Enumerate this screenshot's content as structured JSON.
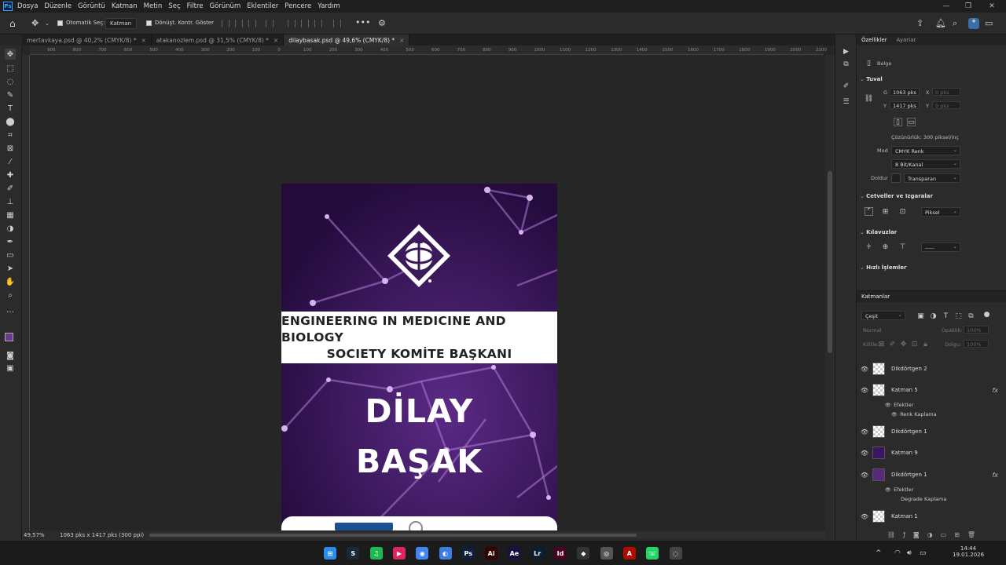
{
  "menu": {
    "items": [
      "Dosya",
      "Düzenle",
      "Görüntü",
      "Katman",
      "Metin",
      "Seç",
      "Filtre",
      "Görünüm",
      "Eklentiler",
      "Pencere",
      "Yardım"
    ],
    "logo": "Ps"
  },
  "options": {
    "auto_select_label": "Otomatik Seç:",
    "auto_select_value": "Katman",
    "transform_label": "Dönüşt. Kontr. Göster",
    "more": "•••"
  },
  "tabs": [
    {
      "label": "mertavkaya.psd @ 40,2% (CMYK/8) *",
      "close": "×"
    },
    {
      "label": "atakanozlem.psd @ 31,5% (CMYK/8) *",
      "close": "×"
    },
    {
      "label": "dilaybasak.psd @ 49,6% (CMYK/8) *",
      "close": "×"
    }
  ],
  "ruler_top": [
    "900",
    "800",
    "700",
    "600",
    "500",
    "400",
    "300",
    "200",
    "100",
    "0",
    "100",
    "200",
    "300",
    "400",
    "500",
    "600",
    "700",
    "800",
    "900",
    "1000",
    "1100",
    "1200",
    "1300",
    "1400",
    "1500",
    "1600",
    "1700",
    "1800",
    "1900",
    "2000",
    "2100"
  ],
  "document": {
    "band_line1": "ENGINEERING IN MEDICINE AND BIOLOGY",
    "band_line2": "SOCIETY KOMİTE BAŞKANI",
    "name_line1": "DİLAY",
    "name_line2": "BAŞAK",
    "colors": {
      "bg": "#2a0f45",
      "accent": "#c48ae8"
    }
  },
  "status": {
    "zoom": "49,57%",
    "size": "1063 pks x 1417 pks (300 ppi)",
    "arrow": "›"
  },
  "properties": {
    "tabs": [
      "Özellikler",
      "Ayarlar"
    ],
    "doc_label": "Belge",
    "canvas_title": "Tuval",
    "w_label": "G",
    "w_value": "1063 pks",
    "h_label": "Y",
    "h_value": "1417 pks",
    "x_label": "X",
    "x_value": "0 pks",
    "y_label": "Y",
    "y_value": "0 pks",
    "resolution": "Çözünürlük: 300 piksel/inç",
    "mode_label": "Mod",
    "mode_value": "CMYK Renk",
    "bit_value": "8 Bit/Kanal",
    "fill_label": "Doldur",
    "fill_value": "Transparan",
    "rulers_title": "Cetveller ve Izgaralar",
    "units_value": "Piksel",
    "guides_title": "Kılavuzlar",
    "guide_style": "-----",
    "quick_title": "Hızlı İşlemler"
  },
  "layers": {
    "title": "Katmanlar",
    "filter": "Çeşit",
    "blend": "Normal",
    "opacity_label": "Opaklık:",
    "opacity_value": "100%",
    "lock_label": "Kilitle:",
    "fill_label": "Dolgu:",
    "fill_value": "100%",
    "rows": [
      {
        "name": "Dikdörtgen 2",
        "thumb": "checker",
        "fx": ""
      },
      {
        "name": "Katman 5",
        "thumb": "checker",
        "fx": "fx"
      },
      {
        "name": "Dikdörtgen 1",
        "thumb": "checker",
        "fx": ""
      },
      {
        "name": "Katman 9",
        "thumb": "purple",
        "fx": ""
      },
      {
        "name": "Dikdörtgen 1",
        "thumb": "violet",
        "fx": "fx"
      },
      {
        "name": "Katman 1",
        "thumb": "checker",
        "fx": ""
      }
    ],
    "effects_label": "Efektler",
    "effect_color": "Renk Kaplama",
    "effect_gradient": "Degrade Kaplama"
  },
  "taskbar": {
    "time": "14:44",
    "date": "19.01.2026",
    "apps": [
      {
        "label": "⊞",
        "color": "#2a8cf0"
      },
      {
        "label": "S",
        "color": "#1b2838"
      },
      {
        "label": "♫",
        "color": "#1db954"
      },
      {
        "label": "▶",
        "color": "#e0245e"
      },
      {
        "label": "◉",
        "color": "#4285f4"
      },
      {
        "label": "◐",
        "color": "#3b7de0"
      },
      {
        "label": "Ps",
        "color": "#0d1f3c"
      },
      {
        "label": "Ai",
        "color": "#330000"
      },
      {
        "label": "Ae",
        "color": "#1a1040"
      },
      {
        "label": "Lr",
        "color": "#0b1e32"
      },
      {
        "label": "Id",
        "color": "#49021f"
      },
      {
        "label": "◆",
        "color": "#333333"
      },
      {
        "label": "◎",
        "color": "#555555"
      },
      {
        "label": "A",
        "color": "#b30b00"
      },
      {
        "label": "☏",
        "color": "#25d366"
      },
      {
        "label": "◌",
        "color": "#444444"
      }
    ]
  }
}
